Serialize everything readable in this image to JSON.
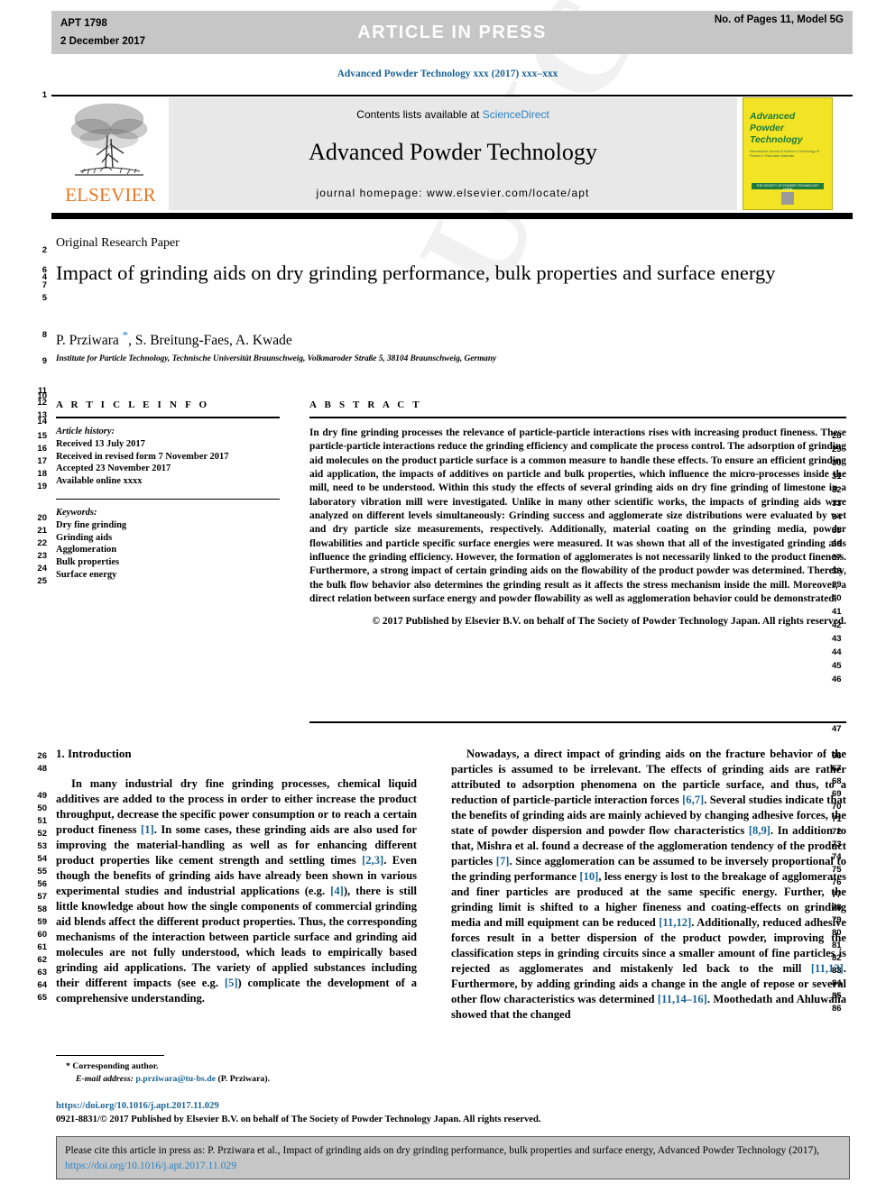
{
  "banner": {
    "article_id": "APT 1798",
    "date": "2 December 2017",
    "status": "ARTICLE  IN  PRESS",
    "pages_model": "No. of Pages 11, Model 5G"
  },
  "running_head": "Advanced Powder Technology xxx (2017) xxx–xxx",
  "masthead": {
    "contents_prefix": "Contents lists available at ",
    "sciencedirect": "ScienceDirect",
    "journal_name": "Advanced Powder Technology",
    "homepage": "journal homepage: www.elsevier.com/locate/apt",
    "publisher": "ELSEVIER",
    "cover": {
      "line1": "Advanced",
      "line2": "Powder",
      "line3": "Technology",
      "subtitle": "International Journal of Science & Technology of Powder & Particulate Materials",
      "bar_text": "THE SOCIETY OF POWDER TECHNOLOGY JAPAN"
    }
  },
  "article": {
    "type": "Original Research Paper",
    "title": "Impact of grinding aids on dry grinding performance, bulk properties and surface energy",
    "authors_pre": "P. Prziwara ",
    "authors_star": "*",
    "authors_post": ", S. Breitung-Faes, A. Kwade",
    "affiliation": "Institute for Particle Technology, Technische Universität Braunschweig, Volkmaroder Straße 5, 38104 Braunschweig, Germany"
  },
  "info": {
    "heading": "A R T I C L E   I N F O",
    "history_label": "Article history:",
    "history": [
      "Received 13 July 2017",
      "Received in revised form 7 November 2017",
      "Accepted 23 November 2017",
      "Available online xxxx"
    ],
    "keywords_label": "Keywords:",
    "keywords": [
      "Dry fine grinding",
      "Grinding aids",
      "Agglomeration",
      "Bulk properties",
      "Surface energy"
    ]
  },
  "abstract": {
    "heading": "A B S T R A C T",
    "body": "In dry fine grinding processes the relevance of particle-particle interactions rises with increasing product fineness. These particle-particle interactions reduce the grinding efficiency and complicate the process control. The adsorption of grinding aid molecules on the product particle surface is a common measure to handle these effects. To ensure an efficient grinding aid application, the impacts of additives on particle and bulk properties, which influence the micro-processes inside the mill, need to be understood. Within this study the effects of several grinding aids on dry fine grinding of limestone in a laboratory vibration mill were investigated. Unlike in many other scientific works, the impacts of grinding aids were analyzed on different levels simultaneously: Grinding success and agglomerate size distributions were evaluated by wet and dry particle size measurements, respectively. Additionally, material coating on the grinding media, powder flowabilities and particle specific surface energies were measured. It was shown that all of the investigated grinding aids influence the grinding efficiency. However, the formation of agglomerates is not necessarily linked to the product fineness. Furthermore, a strong impact of certain grinding aids on the flowability of the product powder was determined. Thereby, the bulk flow behavior also determines the grinding result as it affects the stress mechanism inside the mill. Moreover, a direct relation between surface energy and powder flowability as well as agglomeration behavior could be demonstrated.",
    "copyright": "© 2017 Published by Elsevier B.V. on behalf of The Society of Powder Technology Japan. All rights reserved."
  },
  "body": {
    "section_heading": "1. Introduction",
    "left_para": [
      "In many industrial dry fine grinding processes, chemical liquid additives are added to the process in order to either increase the product throughput, decrease the specific power consumption or to reach a certain product fineness ",
      ". In some cases, these grinding aids are also used for improving the material-handling as well as for enhancing different product properties like cement strength and settling times ",
      ". Even though the benefits of grinding aids have already been shown in various experimental studies and industrial applications (e.g. ",
      "), there is still little knowledge about how the single components of commercial grinding aid blends affect the different product properties. Thus, the corresponding mechanisms of the interaction between particle surface and grinding aid molecules are not fully understood, which leads to empirically based grinding aid applications. The variety of applied substances including their different impacts (see e.g. ",
      ") complicate the development of a comprehensive understanding."
    ],
    "left_refs": [
      "[1]",
      "[2,3]",
      "[4]",
      "[5]"
    ],
    "right_para": [
      "Nowadays, a direct impact of grinding aids on the fracture behavior of the particles is assumed to be irrelevant. The effects of grinding aids are rather attributed to adsorption phenomena on the particle surface, and thus, to a reduction of particle-particle interaction forces ",
      ". Several studies indicate that the benefits of grinding aids are mainly achieved by changing adhesive forces, the state of powder dispersion and powder flow characteristics ",
      ". In addition to that, Mishra et al. found a decrease of the agglomeration tendency of the product particles ",
      ". Since agglomeration can be assumed to be inversely proportional to the grinding performance ",
      ", less energy is lost to the breakage of agglomerates and finer particles are produced at the same specific energy. Further, the grinding limit is shifted to a higher fineness and coating-effects on grinding media and mill equipment can be reduced ",
      ". Additionally, reduced adhesive forces result in a better dispersion of the product powder, improving the classification steps in grinding circuits since a smaller amount of fine particles is rejected as agglomerates and mistakenly led back to the mill ",
      ". Furthermore, by adding grinding aids a change in the angle of repose or several other flow characteristics was determined ",
      ". Moothedath and Ahluwalia showed that the changed"
    ],
    "right_refs": [
      "[6,7]",
      "[8,9]",
      "[7]",
      "[10]",
      "[11,12]",
      "[11,13]",
      "[11,14–16]"
    ]
  },
  "footnote": {
    "corresponding": "* Corresponding author.",
    "email_label": "E-mail address:",
    "email": "p.prziwara@tu-bs.de",
    "email_suffix": " (P. Prziwara)."
  },
  "footer": {
    "doi": "https://doi.org/10.1016/j.apt.2017.11.029",
    "issn": "0921-8831/© 2017 Published by Elsevier B.V. on behalf of The Society of Powder Technology Japan. All rights reserved."
  },
  "cite_box": {
    "prefix": "Please cite this article in press as: P. Prziwara et al., Impact of grinding aids on dry grinding performance, bulk properties and surface energy, Advanced Powder Technology (2017), ",
    "link": "https://doi.org/10.1016/j.apt.2017.11.029"
  },
  "watermark": "UNCORRECTED PROOF",
  "line_numbers": {
    "left": [
      "1",
      "2",
      "6",
      "4",
      "7",
      "5",
      "8",
      "9",
      "11",
      "10",
      "12",
      "13",
      "14",
      "15",
      "16",
      "17",
      "18",
      "19",
      "20",
      "21",
      "22",
      "23",
      "24",
      "25",
      "26",
      "48",
      "49",
      "50",
      "51",
      "52",
      "53",
      "54",
      "55",
      "56",
      "57",
      "58",
      "59",
      "60",
      "61",
      "62",
      "63",
      "64",
      "65"
    ],
    "right": [
      "28",
      "29",
      "30",
      "31",
      "32",
      "33",
      "34",
      "35",
      "36",
      "37",
      "38",
      "39",
      "40",
      "41",
      "42",
      "43",
      "44",
      "45",
      "46",
      "47",
      "66",
      "67",
      "68",
      "69",
      "70",
      "71",
      "72",
      "73",
      "74",
      "75",
      "76",
      "77",
      "78",
      "79",
      "80",
      "81",
      "82",
      "83",
      "84",
      "85",
      "86"
    ]
  },
  "colors": {
    "link": "#1a6496",
    "sciencedirect": "#2a83c3",
    "elsevier_orange": "#e87722",
    "banner_grey": "#c6c6c6",
    "cover_yellow": "#f2e424"
  }
}
